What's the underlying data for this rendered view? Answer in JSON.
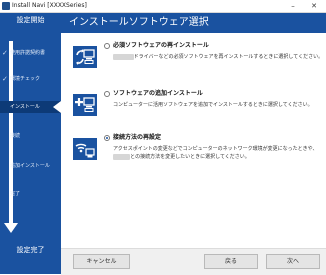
{
  "window": {
    "title": "Install Navi [XXXXSeries]",
    "minimize": "–",
    "close": "✕"
  },
  "sidebar": {
    "title": "設定開始",
    "footer": "設定完了",
    "steps": [
      {
        "label": "使用許諾契約書",
        "done": true
      },
      {
        "label": "環境チェック",
        "done": true
      },
      {
        "label": "インストール",
        "active": true
      },
      {
        "label": "接続"
      },
      {
        "label": "追加インストール"
      },
      {
        "label": "完了"
      }
    ]
  },
  "header": {
    "title": "インストールソフトウェア選択"
  },
  "options": [
    {
      "title": "必須ソフトウェアの再インストール",
      "desc_pre": "",
      "desc_post": "ドライバーなどの必須ソフトウェアを再インストールするときに選択してください。",
      "selected": false,
      "icon": "reinstall-icon"
    },
    {
      "title": "ソフトウェアの追加インストール",
      "desc_pre": "コンピューターに活用ソフトウェアを追加でインストールするときに選択してください。",
      "desc_post": "",
      "selected": false,
      "icon": "add-install-icon"
    },
    {
      "title": "接続方法の再設定",
      "desc_pre": "アクセスポイントの変更などでコンピューターのネットワーク環境が変更になったときや、",
      "desc_post": "との接続方法を変更したいときに選択してください。",
      "selected": true,
      "icon": "reconnect-icon"
    }
  ],
  "buttons": {
    "cancel": "キャンセル",
    "back": "戻る",
    "next": "次へ"
  },
  "colors": {
    "sidebar": "#1a52a0",
    "sidebar_active": "#0d3a77",
    "icon": "#1a52a0"
  }
}
